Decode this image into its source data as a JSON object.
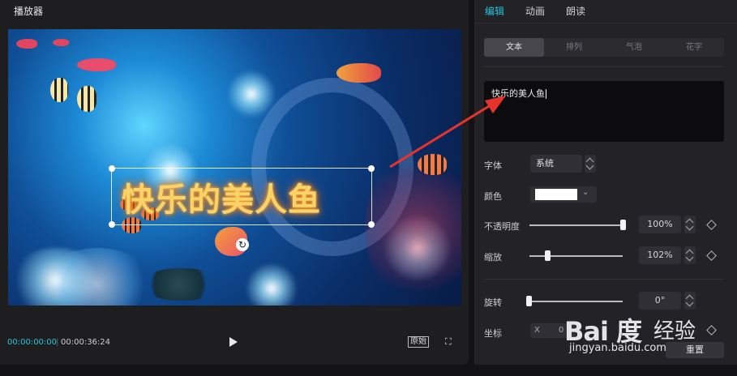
{
  "player": {
    "title": "播放器",
    "overlay_text": "快乐的美人鱼",
    "time_current": "00:00:00:00",
    "time_total": "00:00:36:24",
    "original_label": "原始"
  },
  "panel": {
    "tabs": [
      {
        "label": "编辑",
        "active": true
      },
      {
        "label": "动画",
        "active": false
      },
      {
        "label": "朗读",
        "active": false
      }
    ],
    "subtabs": [
      {
        "label": "文本",
        "active": true
      },
      {
        "label": "排列",
        "active": false
      },
      {
        "label": "气泡",
        "active": false
      },
      {
        "label": "花字",
        "active": false
      }
    ],
    "text_value": "快乐的美人鱼",
    "font_label": "字体",
    "font_value": "系统",
    "color_label": "颜色",
    "color_value": "#ffffff",
    "opacity_label": "不透明度",
    "opacity_value": "100%",
    "opacity_level": 1.0,
    "scale_label": "缩放",
    "scale_value": "102%",
    "rotate_label": "旋转",
    "rotate_value": "0°",
    "position_label": "坐标",
    "position_x_label": "X",
    "position_x_value": "0",
    "reset_label": "重置"
  },
  "watermark": {
    "logo": "Bai 度",
    "text": "经验",
    "url": "jingyan.baidu.com"
  },
  "colors": {
    "accent": "#21c3d8",
    "arrow": "#e8332d"
  }
}
